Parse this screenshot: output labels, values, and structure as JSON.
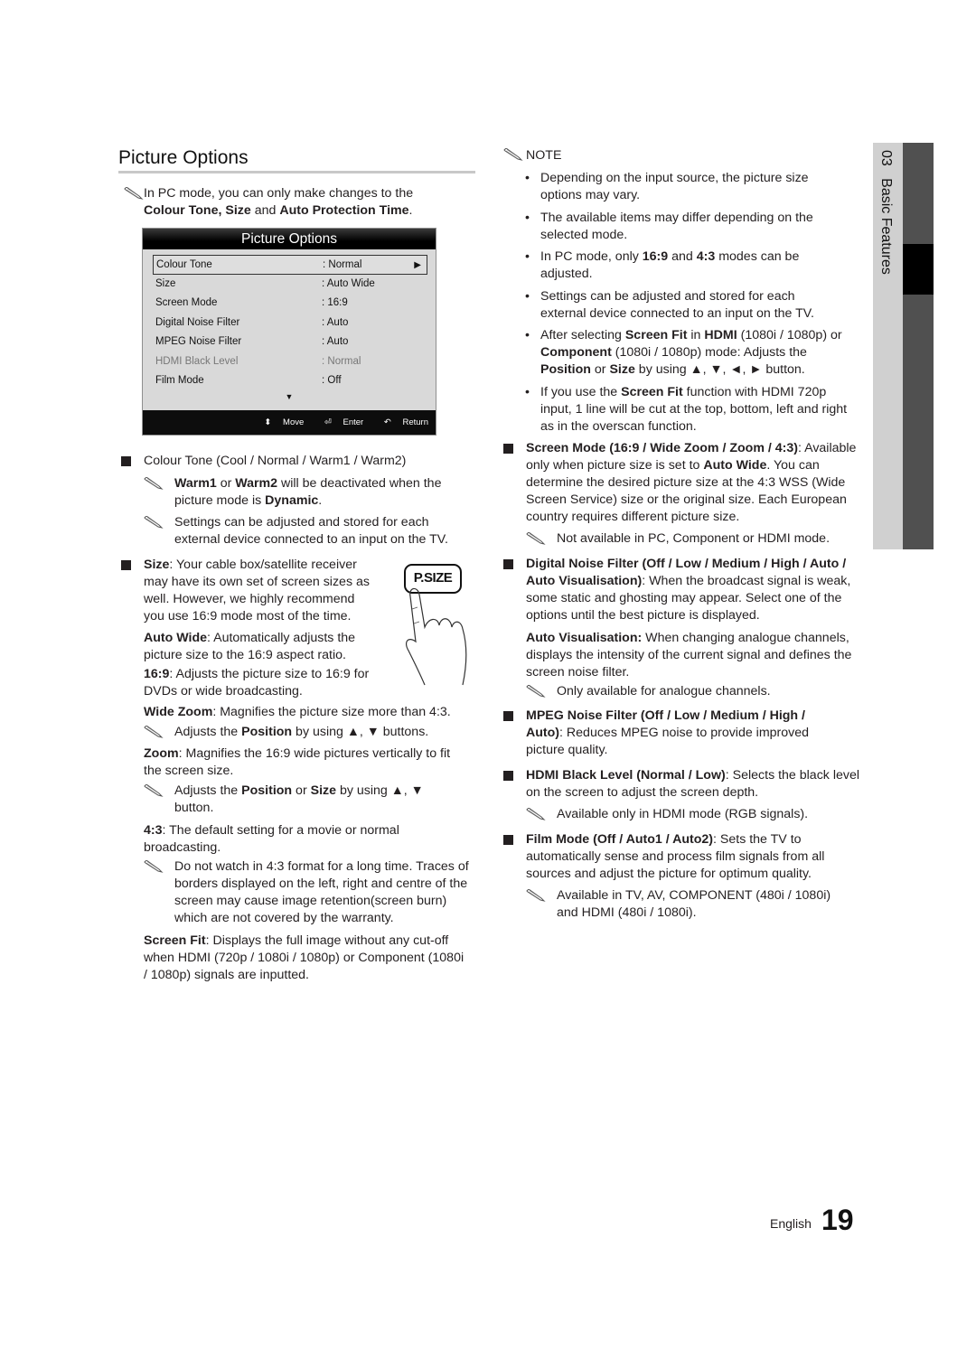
{
  "page": {
    "section_title": "Picture Options",
    "chapter_number": "03",
    "chapter_title": "Basic Features",
    "footer_language": "English",
    "page_number": "19"
  },
  "intro_note": {
    "icon": "pencil-note-icon",
    "line1": "In PC mode, you can only make changes to the",
    "bold1": "Colour Tone, Size",
    "mid": " and ",
    "bold2": "Auto Protection Time",
    "end": "."
  },
  "osd_menu": {
    "title": "Picture Options",
    "rows": [
      {
        "label": "Colour Tone",
        "value": ": Normal",
        "selected": true,
        "dimmed": false
      },
      {
        "label": "Size",
        "value": ": Auto Wide",
        "selected": false,
        "dimmed": false
      },
      {
        "label": "Screen Mode",
        "value": ": 16:9",
        "selected": false,
        "dimmed": false
      },
      {
        "label": "Digital Noise Filter",
        "value": ": Auto",
        "selected": false,
        "dimmed": false
      },
      {
        "label": "MPEG Noise Filter",
        "value": ": Auto",
        "selected": false,
        "dimmed": false
      },
      {
        "label": "HDMI Black Level",
        "value": ": Normal",
        "selected": false,
        "dimmed": true
      },
      {
        "label": "Film Mode",
        "value": ": Off",
        "selected": false,
        "dimmed": false
      }
    ],
    "right_arrow": "▶",
    "more_arrow": "▼",
    "footer": {
      "move": "Move",
      "enter": "Enter",
      "return": "Return",
      "move_icon": "⬍",
      "enter_icon": "⏎",
      "return_icon": "↶"
    }
  },
  "left_col": {
    "colour_tone": {
      "heading": "Colour Tone (Cool / Normal / Warm1 / Warm2)",
      "note1_b1": "Warm1",
      "note1_m1": " or ",
      "note1_b2": "Warm2",
      "note1_m2": " will be deactivated when the picture mode is ",
      "note1_b3": "Dynamic",
      "note1_end": ".",
      "note2": "Settings can be adjusted and stored for each external device connected to an input on the TV."
    },
    "size": {
      "heading": "Size",
      "text": ": Your cable box/satellite receiver may have its own set of screen sizes as well. However, we highly recommend you use 16:9 mode most of the time.",
      "button_label": "P.SIZE",
      "auto_wide_b": "Auto Wide",
      "auto_wide_t": ": Automatically adjusts the picture size to the 16:9 aspect ratio.",
      "r169_b": "16:9",
      "r169_t": ": Adjusts the picture size to 16:9 for DVDs or wide broadcasting.",
      "wide_zoom_b": "Wide Zoom",
      "wide_zoom_t": ": Magnifies the picture size more than 4:3.",
      "wide_zoom_note_a": "Adjusts the ",
      "wide_zoom_note_b": "Position",
      "wide_zoom_note_c": " by using ▲, ▼ buttons.",
      "zoom_b": "Zoom",
      "zoom_t": ": Magnifies the 16:9 wide pictures vertically to fit the screen size.",
      "zoom_note_a": "Adjusts the ",
      "zoom_note_b": "Position",
      "zoom_note_c": " or ",
      "zoom_note_d": "Size",
      "zoom_note_e": " by using ▲, ▼ button.",
      "r43_b": "4:3",
      "r43_t": ": The default setting for a movie or normal broadcasting.",
      "r43_note": "Do not watch in 4:3 format for a long time. Traces of borders displayed on the left, right and centre of the screen may cause image retention(screen burn) which are not covered by the warranty.",
      "screen_fit_b": "Screen Fit",
      "screen_fit_t": ": Displays the full image without any cut-off when HDMI (720p / 1080i / 1080p) or Component (1080i / 1080p) signals are inputted."
    }
  },
  "right_col": {
    "note_heading": "NOTE",
    "bullet_char": "•",
    "bullets": {
      "b1": "Depending on the input source, the picture size options may vary.",
      "b2": "The available items may differ depending on the selected mode.",
      "b3_a": "In PC mode, only ",
      "b3_b": "16:9",
      "b3_c": " and ",
      "b3_d": "4:3",
      "b3_e": " modes can be adjusted.",
      "b4": "Settings can be adjusted and stored for each external device connected to an input on the TV.",
      "b5_a": "After selecting ",
      "b5_b": "Screen Fit",
      "b5_c": " in ",
      "b5_d": "HDMI",
      "b5_e": " (1080i / 1080p) or ",
      "b5_f": "Component",
      "b5_g": " (1080i / 1080p) mode: Adjusts the ",
      "b5_h": "Position",
      "b5_i": " or ",
      "b5_j": "Size",
      "b5_k": " by using ▲, ▼, ◄, ► button.",
      "b6_a": "If you use the ",
      "b6_b": "Screen Fit",
      "b6_c": " function with HDMI 720p input, 1 line will be cut at the top, bottom, left and right as in the overscan function."
    },
    "screen_mode": {
      "heading": "Screen Mode (16:9 / Wide Zoom / Zoom / 4:3)",
      "t1": ": Available only when picture size is set to ",
      "t_b": "Auto Wide",
      "t2": ". You can determine the desired picture size at the 4:3 WSS (Wide Screen Service) size or the original size. Each European country requires different picture size.",
      "note": "Not available in PC, Component or HDMI mode."
    },
    "dnf": {
      "heading": "Digital Noise Filter (Off / Low / Medium / High / Auto / Auto Visualisation)",
      "text": ": When the broadcast signal is weak, some static and ghosting may appear. Select one of the options until the best picture is displayed.",
      "av_b": "Auto Visualisation:",
      "av_t": " When changing analogue channels, displays the intensity of the current signal and defines the screen noise filter.",
      "note": "Only available for analogue channels."
    },
    "mpeg": {
      "heading": "MPEG Noise Filter (Off / Low / Medium / High / Auto)",
      "text": ": Reduces MPEG noise to provide improved picture quality."
    },
    "hdmi_black": {
      "heading": "HDMI Black Level (Normal / Low)",
      "text": ": Selects the black level on the screen to adjust the screen depth.",
      "note": "Available only in HDMI mode (RGB signals)."
    },
    "film_mode": {
      "heading": "Film Mode (Off / Auto1 / Auto2)",
      "text": ": Sets the TV to automatically sense and process film signals from all sources and adjust the picture for optimum quality.",
      "note": "Available in TV, AV, COMPONENT (480i / 1080i) and HDMI (480i / 1080i)."
    }
  }
}
